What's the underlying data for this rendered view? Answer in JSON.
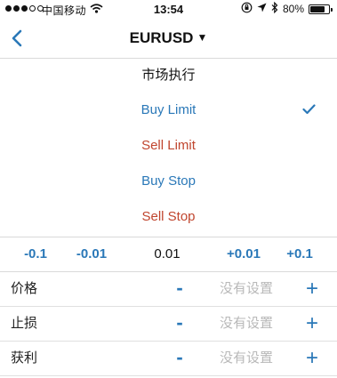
{
  "status_bar": {
    "carrier": "中国移动",
    "time": "13:54",
    "battery": "80%",
    "battery_level": 0.8
  },
  "nav": {
    "title": "EURUSD",
    "caret": "▼"
  },
  "order_types": [
    {
      "label": "市场执行",
      "color": "#111111",
      "selected": false
    },
    {
      "label": "Buy Limit",
      "color": "#2a78b8",
      "selected": true
    },
    {
      "label": "Sell Limit",
      "color": "#c0452e",
      "selected": false
    },
    {
      "label": "Buy Stop",
      "color": "#2a78b8",
      "selected": false
    },
    {
      "label": "Sell Stop",
      "color": "#c0452e",
      "selected": false
    }
  ],
  "volume": {
    "dec_large": "-0.1",
    "dec_small": "-0.01",
    "value": "0.01",
    "inc_small": "+0.01",
    "inc_large": "+0.1"
  },
  "params": [
    {
      "label": "价格",
      "minus": "-",
      "placeholder": "没有设置",
      "plus": "+"
    },
    {
      "label": "止损",
      "minus": "-",
      "placeholder": "没有设置",
      "plus": "+"
    },
    {
      "label": "获利",
      "minus": "-",
      "placeholder": "没有设置",
      "plus": "+"
    }
  ],
  "colors": {
    "accent": "#2a78b8",
    "sell": "#c0452e",
    "placeholder": "#b8b8b8"
  }
}
